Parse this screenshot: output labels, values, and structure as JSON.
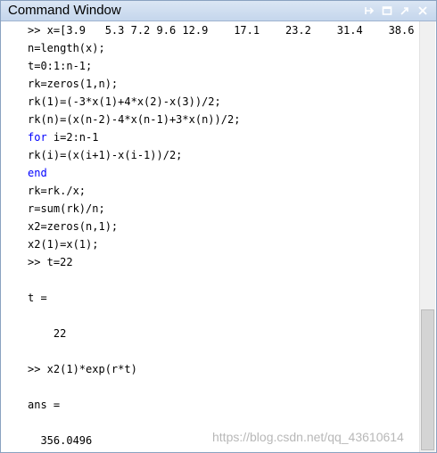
{
  "window": {
    "title": "Command Window",
    "controls": [
      "pin-icon",
      "maximize-icon",
      "undock-icon",
      "close-icon"
    ]
  },
  "lines": [
    {
      "text": ">> x=[3.9   5.3 7.2 9.6 12.9    17.1    23.2    31.4    38.6",
      "type": "code"
    },
    {
      "text": "n=length(x);",
      "type": "code"
    },
    {
      "text": "t=0:1:n-1;",
      "type": "code"
    },
    {
      "text": "rk=zeros(1,n);",
      "type": "code"
    },
    {
      "text": "rk(1)=(-3*x(1)+4*x(2)-x(3))/2;",
      "type": "code"
    },
    {
      "text": "rk(n)=(x(n-2)-4*x(n-1)+3*x(n))/2;",
      "type": "code"
    },
    {
      "text": "for",
      "rest": " i=2:n-1",
      "type": "keyword"
    },
    {
      "text": "rk(i)=(x(i+1)-x(i-1))/2;",
      "type": "code"
    },
    {
      "text": "end",
      "type": "keyword-only"
    },
    {
      "text": "rk=rk./x;",
      "type": "code"
    },
    {
      "text": "r=sum(rk)/n;",
      "type": "code"
    },
    {
      "text": "x2=zeros(n,1);",
      "type": "code"
    },
    {
      "text": "x2(1)=x(1);",
      "type": "code"
    },
    {
      "text": ">> t=22",
      "type": "code"
    },
    {
      "text": "t =",
      "type": "output"
    },
    {
      "text": "    22",
      "type": "output"
    },
    {
      "text": ">> x2(1)*exp(r*t)",
      "type": "code"
    },
    {
      "text": "ans =",
      "type": "output"
    },
    {
      "text": "  356.0496",
      "type": "output"
    }
  ],
  "watermark": "https://blog.csdn.net/qq_43610614"
}
